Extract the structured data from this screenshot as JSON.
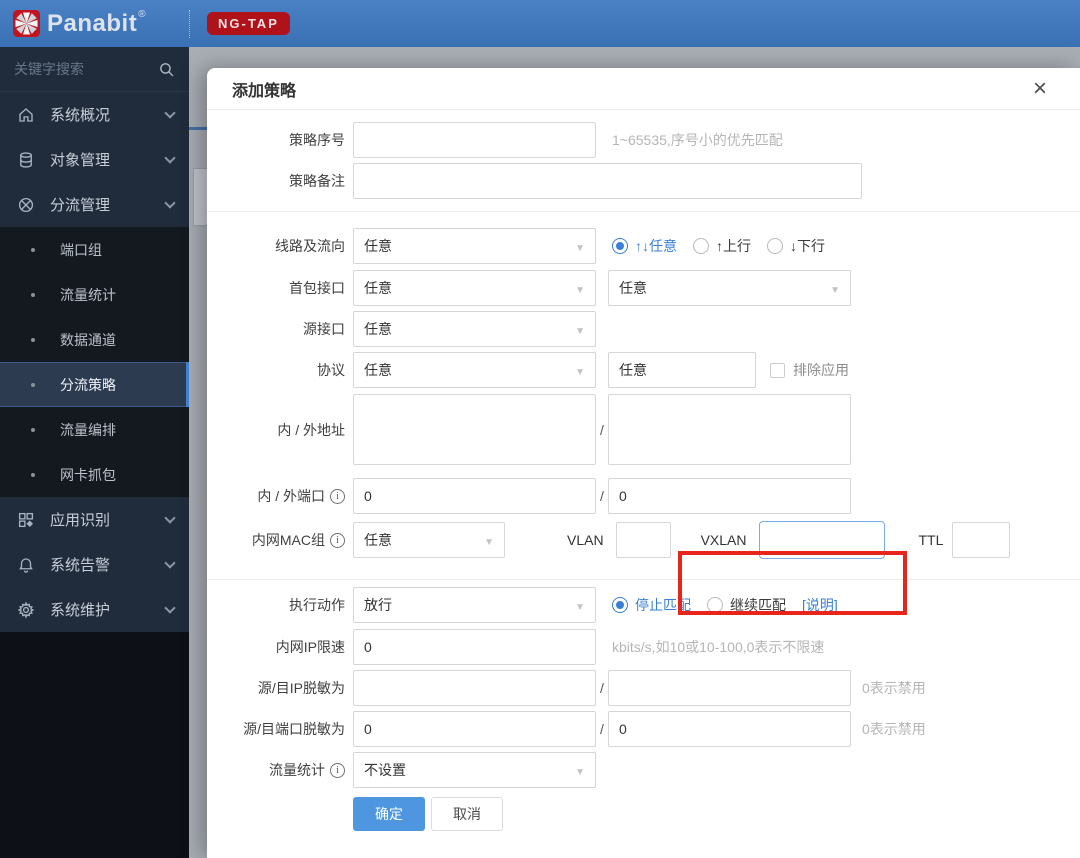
{
  "colors": {
    "accent": "#3a7fd5",
    "topbar": "#4078bd",
    "badge_bg": "#b01219",
    "annotation": "#e7251b",
    "ok_button": "#4e97e0",
    "sidebar_bg": "#202c3b"
  },
  "topbar": {
    "brand": "Panabit",
    "reg": "®",
    "badge": "NG-TAP"
  },
  "sidebar": {
    "search_placeholder": "关键字搜索",
    "items": [
      {
        "label": "系统概况"
      },
      {
        "label": "对象管理"
      },
      {
        "label": "分流管理"
      },
      {
        "label": "端口组"
      },
      {
        "label": "流量统计"
      },
      {
        "label": "数据通道"
      },
      {
        "label": "分流策略"
      },
      {
        "label": "流量编排"
      },
      {
        "label": "网卡抓包"
      },
      {
        "label": "应用识别"
      },
      {
        "label": "系统告警"
      },
      {
        "label": "系统维护"
      }
    ]
  },
  "modal": {
    "title": "添加策略",
    "close": "×",
    "slash": "/",
    "fields": {
      "policy_no": {
        "label": "策略序号",
        "value": "",
        "hint": "1~65535,序号小的优先匹配"
      },
      "policy_note": {
        "label": "策略备注",
        "value": ""
      },
      "line_dir": {
        "label": "线路及流向",
        "select": "任意",
        "radio_any_icon": "↑↓",
        "radio_any": "任意",
        "radio_up_icon": "↑",
        "radio_up": "上行",
        "radio_down_icon": "↓",
        "radio_down": "下行"
      },
      "first_pkt": {
        "label": "首包接口",
        "select1": "任意",
        "select2": "任意"
      },
      "src_if": {
        "label": "源接口",
        "select": "任意"
      },
      "protocol": {
        "label": "协议",
        "select": "任意",
        "value": "任意",
        "checkbox_label": "排除应用"
      },
      "addr": {
        "label": "内 / 外地址",
        "value1": "",
        "value2": ""
      },
      "port": {
        "label": "内 / 外端口",
        "value1": "0",
        "value2": "0"
      },
      "mac": {
        "label": "内网MAC组",
        "select": "任意",
        "vlan_label": "VLAN",
        "vlan_value": "",
        "vxlan_label": "VXLAN",
        "vxlan_value": "",
        "ttl_label": "TTL",
        "ttl_value": ""
      },
      "action": {
        "label": "执行动作",
        "select": "放行",
        "radio_stop": "停止匹配",
        "radio_continue": "继续匹配",
        "link": "[说明]"
      },
      "ip_limit": {
        "label": "内网IP限速",
        "value": "0",
        "hint": "kbits/s,如10或10-100,0表示不限速"
      },
      "ip_mask": {
        "label": "源/目IP脱敏为",
        "value1": "",
        "value2": "",
        "hint": "0表示禁用"
      },
      "port_mask": {
        "label": "源/目端口脱敏为",
        "value1": "0",
        "value2": "0",
        "hint": "0表示禁用"
      },
      "traffic_stat": {
        "label": "流量统计",
        "select": "不设置"
      }
    },
    "buttons": {
      "ok": "确定",
      "cancel": "取消"
    }
  }
}
